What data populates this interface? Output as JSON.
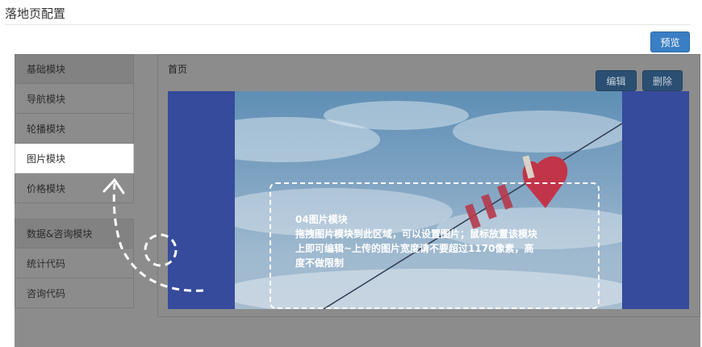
{
  "page": {
    "title": "落地页配置"
  },
  "toolbar": {
    "preview_label": "预览"
  },
  "sidebar": {
    "groups": [
      {
        "items": [
          {
            "label": "基础模块"
          },
          {
            "label": "导航模块"
          },
          {
            "label": "轮播模块"
          },
          {
            "label": "图片模块"
          },
          {
            "label": "价格模块"
          }
        ]
      },
      {
        "items": [
          {
            "label": "数据&咨询模块"
          },
          {
            "label": "统计代码"
          },
          {
            "label": "咨询代码"
          }
        ]
      }
    ],
    "active_item": "图片模块"
  },
  "main": {
    "title": "首页",
    "edit_label": "编辑",
    "delete_label": "删除",
    "dropzone": {
      "line1": "04图片模块",
      "line2": "拖拽图片模块到此区域，可以设置图片；鼠标放置该模块",
      "line3": "上即可编辑~上传的图片宽度请不要超过1170像素，高",
      "line4": "度不做限制"
    }
  },
  "colors": {
    "primary": "#3a7fc4",
    "dark_button": "#2b4f73",
    "banner_side": "#364b9b",
    "overlay": "#8c8c8c"
  },
  "icons": [
    "curved-dashed-arrow-icon",
    "dashed-circle-icon"
  ]
}
